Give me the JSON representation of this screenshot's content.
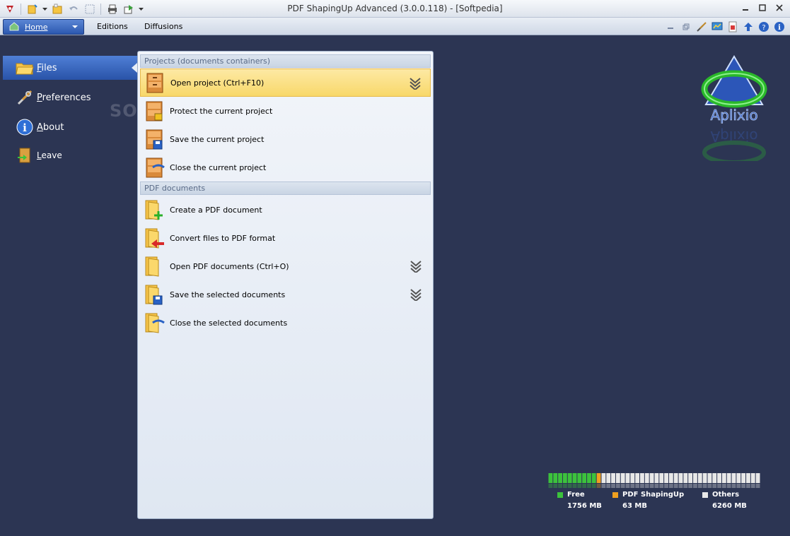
{
  "window": {
    "title": "PDF ShapingUp Advanced (3.0.0.118) - [Softpedia]"
  },
  "menubar": {
    "home_label": "Home",
    "items": [
      "Editions",
      "Diffusions"
    ]
  },
  "nav": {
    "items": [
      {
        "label": "Files",
        "icon": "folder-icon",
        "active": true
      },
      {
        "label": "Preferences",
        "icon": "tools-icon",
        "active": false
      },
      {
        "label": "About",
        "icon": "info-icon",
        "active": false
      },
      {
        "label": "Leave",
        "icon": "exit-door-icon",
        "active": false
      }
    ],
    "watermark": "SOFTPEDIA"
  },
  "panel": {
    "sections": [
      {
        "header": "Projects (documents containers)",
        "commands": [
          {
            "label": "Open project (Ctrl+F10)",
            "icon": "cabinet-icon",
            "highlighted": true,
            "has_more": true
          },
          {
            "label": "Protect the current project",
            "icon": "cabinet-lock-icon",
            "highlighted": false,
            "has_more": false
          },
          {
            "label": "Save the current project",
            "icon": "cabinet-save-icon",
            "highlighted": false,
            "has_more": false
          },
          {
            "label": "Close the current project",
            "icon": "cabinet-close-icon",
            "highlighted": false,
            "has_more": false
          }
        ]
      },
      {
        "header": "PDF documents",
        "commands": [
          {
            "label": "Create a PDF document",
            "icon": "folder-add-icon",
            "highlighted": false,
            "has_more": false
          },
          {
            "label": "Convert files to PDF format",
            "icon": "folder-convert-icon",
            "highlighted": false,
            "has_more": false
          },
          {
            "label": "Open PDF documents (Ctrl+O)",
            "icon": "folder-open-icon",
            "highlighted": false,
            "has_more": true
          },
          {
            "label": "Save the selected documents",
            "icon": "folder-save-icon",
            "highlighted": false,
            "has_more": true
          },
          {
            "label": "Close the selected documents",
            "icon": "folder-close-icon",
            "highlighted": false,
            "has_more": false
          }
        ]
      }
    ]
  },
  "logo": {
    "text": "Aplixio"
  },
  "memory": {
    "free": {
      "label": "Free",
      "value": "1756 MB",
      "color": "#3cc23c",
      "mb": 1756
    },
    "app": {
      "label": "PDF ShapingUp",
      "value": "63 MB",
      "color": "#f0a020",
      "mb": 63
    },
    "others": {
      "label": "Others",
      "value": "6260 MB",
      "color": "#e8e8e8",
      "mb": 6260
    }
  },
  "colors": {
    "background": "#2c3553",
    "active_nav": "#3a68c2",
    "highlight": "#f8d86a"
  }
}
